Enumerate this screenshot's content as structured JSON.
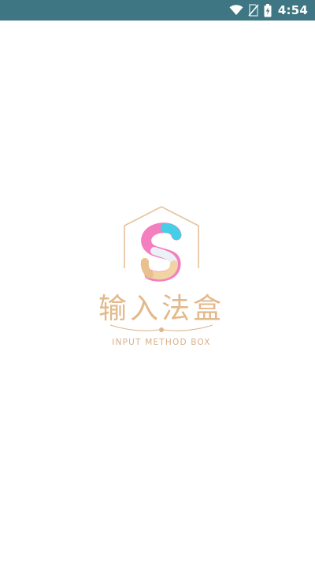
{
  "status_bar": {
    "time": "4:54",
    "icons": [
      "wifi-icon",
      "no-sim-icon",
      "battery-charging-icon"
    ],
    "background": "#3e7683"
  },
  "splash": {
    "title": "输入法盒",
    "subtitle": "INPUT METHOD BOX",
    "logo_letter": "S",
    "accent_color": "#e2b98b"
  }
}
